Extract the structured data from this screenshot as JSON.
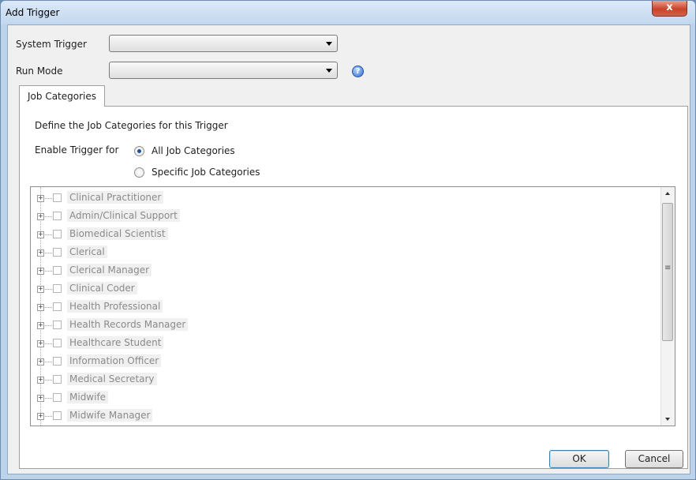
{
  "window": {
    "title": "Add Trigger",
    "close_label": "x"
  },
  "form": {
    "system_trigger_label": "System Trigger",
    "system_trigger_value": "",
    "run_mode_label": "Run Mode",
    "run_mode_value": "",
    "help_glyph": "?"
  },
  "tabs": [
    {
      "label": "Job Categories",
      "selected": true
    }
  ],
  "panel": {
    "description": "Define the Job Categories for this Trigger",
    "enable_label": "Enable Trigger for",
    "radio_all": "All Job Categories",
    "radio_specific": "Specific Job Categories",
    "selected_option": "All Job Categories"
  },
  "tree_items": [
    "Clinical Practitioner",
    "Admin/Clinical Support",
    "Biomedical Scientist",
    "Clerical",
    "Clerical Manager",
    "Clinical Coder",
    "Health Professional",
    "Health Records Manager",
    "Healthcare Student",
    "Information Officer",
    "Medical Secretary",
    "Midwife",
    "Midwife Manager"
  ],
  "buttons": {
    "ok": "OK",
    "cancel": "Cancel"
  }
}
